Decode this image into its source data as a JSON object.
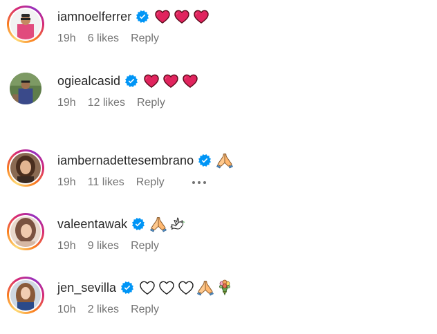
{
  "colors": {
    "verified_blue": "#0095f6",
    "heart_red": "#e0245e",
    "meta_gray": "#737373"
  },
  "comments": [
    {
      "username": "iamnoelferrer",
      "verified": true,
      "emojis": [
        "red-heart",
        "red-heart",
        "red-heart"
      ],
      "time": "19h",
      "likes": "6 likes",
      "reply": "Reply",
      "story_ring": true
    },
    {
      "username": "ogiealcasid",
      "verified": true,
      "emojis": [
        "red-heart",
        "red-heart",
        "red-heart"
      ],
      "time": "19h",
      "likes": "12 likes",
      "reply": "Reply",
      "story_ring": false
    },
    {
      "username": "iambernadettesembrano",
      "verified": true,
      "emojis": [
        "folded-hands"
      ],
      "time": "19h",
      "likes": "11 likes",
      "reply": "Reply",
      "story_ring": true,
      "has_more": true
    },
    {
      "username": "valeentawak",
      "verified": true,
      "emojis": [
        "folded-hands",
        "dove"
      ],
      "time": "19h",
      "likes": "9 likes",
      "reply": "Reply",
      "story_ring": true
    },
    {
      "username": "jen_sevilla",
      "verified": true,
      "emojis": [
        "white-heart",
        "white-heart",
        "white-heart",
        "folded-hands",
        "bouquet"
      ],
      "time": "10h",
      "likes": "2 likes",
      "reply": "Reply",
      "story_ring": true
    }
  ]
}
